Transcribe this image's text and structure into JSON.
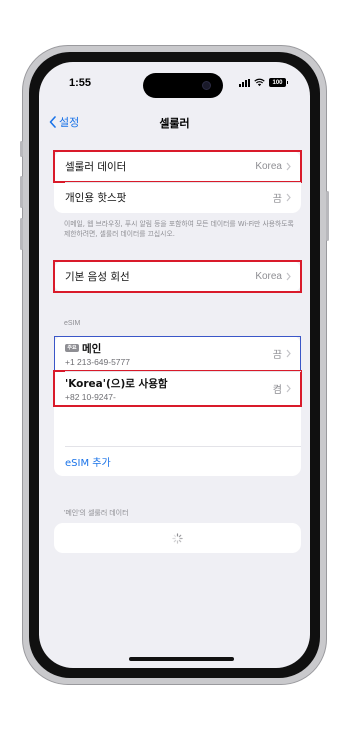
{
  "status_bar": {
    "time": "1:55",
    "battery": "100",
    "icons": [
      "signal-icon",
      "wifi-icon",
      "battery-icon"
    ]
  },
  "nav": {
    "back_label": "설정",
    "title": "셀룰러"
  },
  "cellular_group": {
    "cellular_data": {
      "label": "셀룰러 데이터",
      "value": "Korea"
    },
    "hotspot": {
      "label": "개인용 핫스팟",
      "value": "끔"
    }
  },
  "hotspot_note": "이메일, 웹 브라우징, 푸시 알림 등을 포함하여 모든 데이터를 Wi-Fi만 사용하도록 제한하려면, 셀룰러 데이터를 끄십시오.",
  "voice_group": {
    "default_voice_line": {
      "label": "기본 음성 회선",
      "value": "Korea"
    }
  },
  "esim_section": {
    "header": "eSIM",
    "lines": [
      {
        "badge": "주요",
        "name": "메인",
        "number": "+1 213-649-5777",
        "status": "끔"
      },
      {
        "name": "'Korea'(으)로 사용함",
        "number": "+82 10-9247-",
        "status": "켬"
      }
    ],
    "add_label": "eSIM 추가"
  },
  "data_section": {
    "header": "'메인'의 셀룰러 데이터"
  },
  "colors": {
    "accent": "#1a73e8",
    "highlight": "#d91a2a",
    "background": "#efeff4"
  }
}
